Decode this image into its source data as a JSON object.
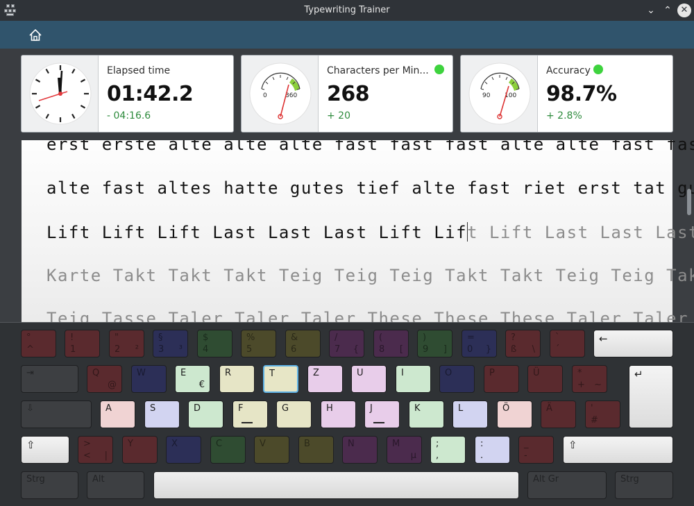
{
  "window": {
    "title": "Typewriting Trainer"
  },
  "toolbar": {
    "home_icon": "home-icon"
  },
  "stats": {
    "elapsed": {
      "label": "Elapsed time",
      "value": "01:42.2",
      "diff": "- 04:16.6"
    },
    "cpm": {
      "label": "Characters per Min...",
      "value": "268",
      "diff": "+ 20",
      "gauge_low": "0",
      "gauge_high": "360"
    },
    "accuracy": {
      "label": "Accuracy",
      "value": "98.7%",
      "diff": "+ 2.8%",
      "gauge_low": "90",
      "gauge_high": "100"
    }
  },
  "text": {
    "line1": "erst erste alte alte alte fast fast fast alte alte fast fast",
    "line2": "alte fast altes hatte gutes tief alte fast riet erst tat gut",
    "line3_typed": "Lift Lift Lift Last Last Last Lift Lif",
    "line3_pending": "t Lift Last Last Last",
    "line4": "Karte Takt Takt Takt Teig Teig Teig Takt Takt Teig Teig Takt",
    "line5": "Teig Tasse Taler Taler Taler These These These Taler Taler"
  },
  "keyboard": {
    "row1": [
      {
        "t": "°",
        "b": "^",
        "r": ""
      },
      {
        "t": "!",
        "b": "1",
        "r": ""
      },
      {
        "t": "\"",
        "b": "2",
        "r": "²"
      },
      {
        "t": "§",
        "b": "3",
        "r": "³"
      },
      {
        "t": "$",
        "b": "4",
        "r": ""
      },
      {
        "t": "%",
        "b": "5",
        "r": ""
      },
      {
        "t": "&",
        "b": "6",
        "r": ""
      },
      {
        "t": "/",
        "b": "7",
        "r": "{"
      },
      {
        "t": "(",
        "b": "8",
        "r": "["
      },
      {
        "t": ")",
        "b": "9",
        "r": "]"
      },
      {
        "t": "=",
        "b": "0",
        "r": "}"
      },
      {
        "t": "?",
        "b": "ß",
        "r": "\\"
      },
      {
        "t": "`",
        "b": "´",
        "r": ""
      },
      {
        "t": "←",
        "b": "",
        "r": ""
      }
    ],
    "row2": [
      {
        "t": "⇥",
        "b": "",
        "r": ""
      },
      {
        "t": "Q",
        "b": "",
        "r": "@"
      },
      {
        "t": "W",
        "b": "",
        "r": ""
      },
      {
        "t": "E",
        "b": "",
        "r": "€"
      },
      {
        "t": "R",
        "b": "",
        "r": ""
      },
      {
        "t": "T",
        "b": "",
        "r": ""
      },
      {
        "t": "Z",
        "b": "",
        "r": ""
      },
      {
        "t": "U",
        "b": "",
        "r": ""
      },
      {
        "t": "I",
        "b": "",
        "r": ""
      },
      {
        "t": "O",
        "b": "",
        "r": ""
      },
      {
        "t": "P",
        "b": "",
        "r": ""
      },
      {
        "t": "Ü",
        "b": "",
        "r": ""
      },
      {
        "t": "*",
        "b": "+",
        "r": "~"
      },
      {
        "t": "↵",
        "b": "",
        "r": ""
      }
    ],
    "row3": [
      {
        "t": "⇩",
        "b": "",
        "r": ""
      },
      {
        "t": "A",
        "b": "",
        "r": ""
      },
      {
        "t": "S",
        "b": "",
        "r": ""
      },
      {
        "t": "D",
        "b": "",
        "r": ""
      },
      {
        "t": "F",
        "b": "",
        "r": ""
      },
      {
        "t": "G",
        "b": "",
        "r": ""
      },
      {
        "t": "H",
        "b": "",
        "r": ""
      },
      {
        "t": "J",
        "b": "",
        "r": ""
      },
      {
        "t": "K",
        "b": "",
        "r": ""
      },
      {
        "t": "L",
        "b": "",
        "r": ""
      },
      {
        "t": "Ö",
        "b": "",
        "r": ""
      },
      {
        "t": "Ä",
        "b": "",
        "r": ""
      },
      {
        "t": "'",
        "b": "#",
        "r": ""
      }
    ],
    "row4": [
      {
        "t": "⇧",
        "b": "",
        "r": ""
      },
      {
        "t": ">",
        "b": "<",
        "r": "|"
      },
      {
        "t": "Y",
        "b": "",
        "r": ""
      },
      {
        "t": "X",
        "b": "",
        "r": ""
      },
      {
        "t": "C",
        "b": "",
        "r": ""
      },
      {
        "t": "V",
        "b": "",
        "r": ""
      },
      {
        "t": "B",
        "b": "",
        "r": ""
      },
      {
        "t": "N",
        "b": "",
        "r": ""
      },
      {
        "t": "M",
        "b": "",
        "r": "µ"
      },
      {
        "t": ";",
        "b": ",",
        "r": ""
      },
      {
        "t": ":",
        "b": ".",
        "r": ""
      },
      {
        "t": "_",
        "b": "-",
        "r": ""
      },
      {
        "t": "⇧",
        "b": "",
        "r": ""
      }
    ],
    "row5": [
      {
        "t": "Strg",
        "b": "",
        "r": ""
      },
      {
        "t": "Alt",
        "b": "",
        "r": ""
      },
      {
        "t": "",
        "b": "",
        "r": ""
      },
      {
        "t": "Alt Gr",
        "b": "",
        "r": ""
      },
      {
        "t": "Strg",
        "b": "",
        "r": ""
      }
    ]
  },
  "colors": {
    "accent": "#30546c",
    "diff_positive": "#2e8b3d",
    "indicator": "#3ed33e",
    "key_highlight": "#5fb3e6"
  }
}
